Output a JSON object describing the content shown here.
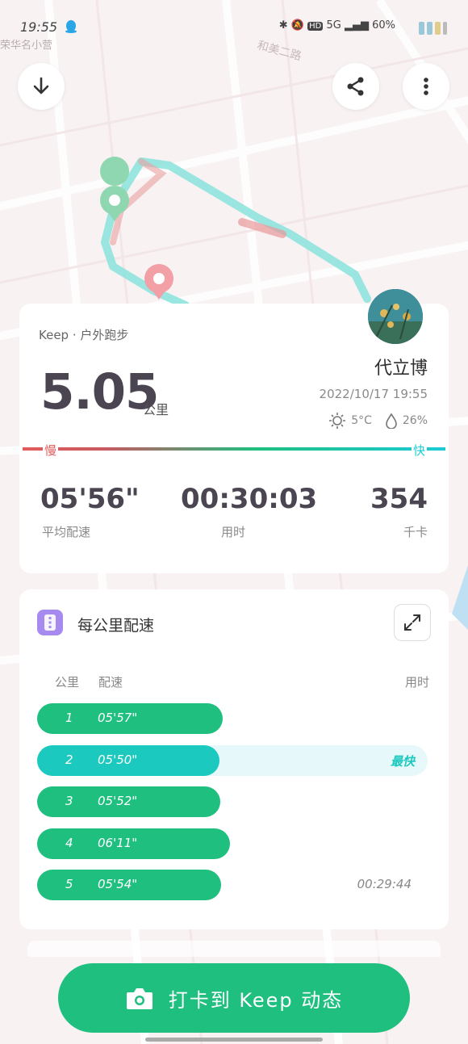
{
  "status_bar": {
    "time": "19:55",
    "network": "5G",
    "hd": "HD",
    "battery": "60%"
  },
  "map": {
    "street_labels": [
      "和美二路"
    ],
    "place_label": "荣华名小营"
  },
  "summary": {
    "sport_type": "Keep · 户外跑步",
    "distance": "5.05",
    "distance_unit": "公里",
    "username": "代立博",
    "datetime": "2022/10/17 19:55",
    "temperature": "5°C",
    "humidity": "26%",
    "speed_slow": "慢",
    "speed_fast": "快",
    "stats": [
      {
        "value": "05'56\"",
        "label": "平均配速"
      },
      {
        "value": "00:30:03",
        "label": "用时"
      },
      {
        "value": "354",
        "label": "千卡"
      }
    ]
  },
  "pace_card": {
    "title": "每公里配速",
    "col_km": "公里",
    "col_pace": "配速",
    "col_time": "用时",
    "rows": [
      {
        "km": "1",
        "pace": "05'57\"",
        "note": "",
        "fill": 0.475,
        "fastest": false
      },
      {
        "km": "2",
        "pace": "05'50\"",
        "note": "最快",
        "fill": 0.466,
        "fastest": true
      },
      {
        "km": "3",
        "pace": "05'52\"",
        "note": "",
        "fill": 0.469,
        "fastest": false
      },
      {
        "km": "4",
        "pace": "06'11\"",
        "note": "",
        "fill": 0.494,
        "fastest": false
      },
      {
        "km": "5",
        "pace": "05'54\"",
        "note": "00:29:44",
        "fill": 0.471,
        "fastest": false
      }
    ]
  },
  "checkin": {
    "label": "打卡到 Keep 动态"
  },
  "colors": {
    "green": "#1fbf7f",
    "teal": "#1ccbd6",
    "slow_red": "#e35b5b",
    "icon_purple": "#a68af0"
  }
}
